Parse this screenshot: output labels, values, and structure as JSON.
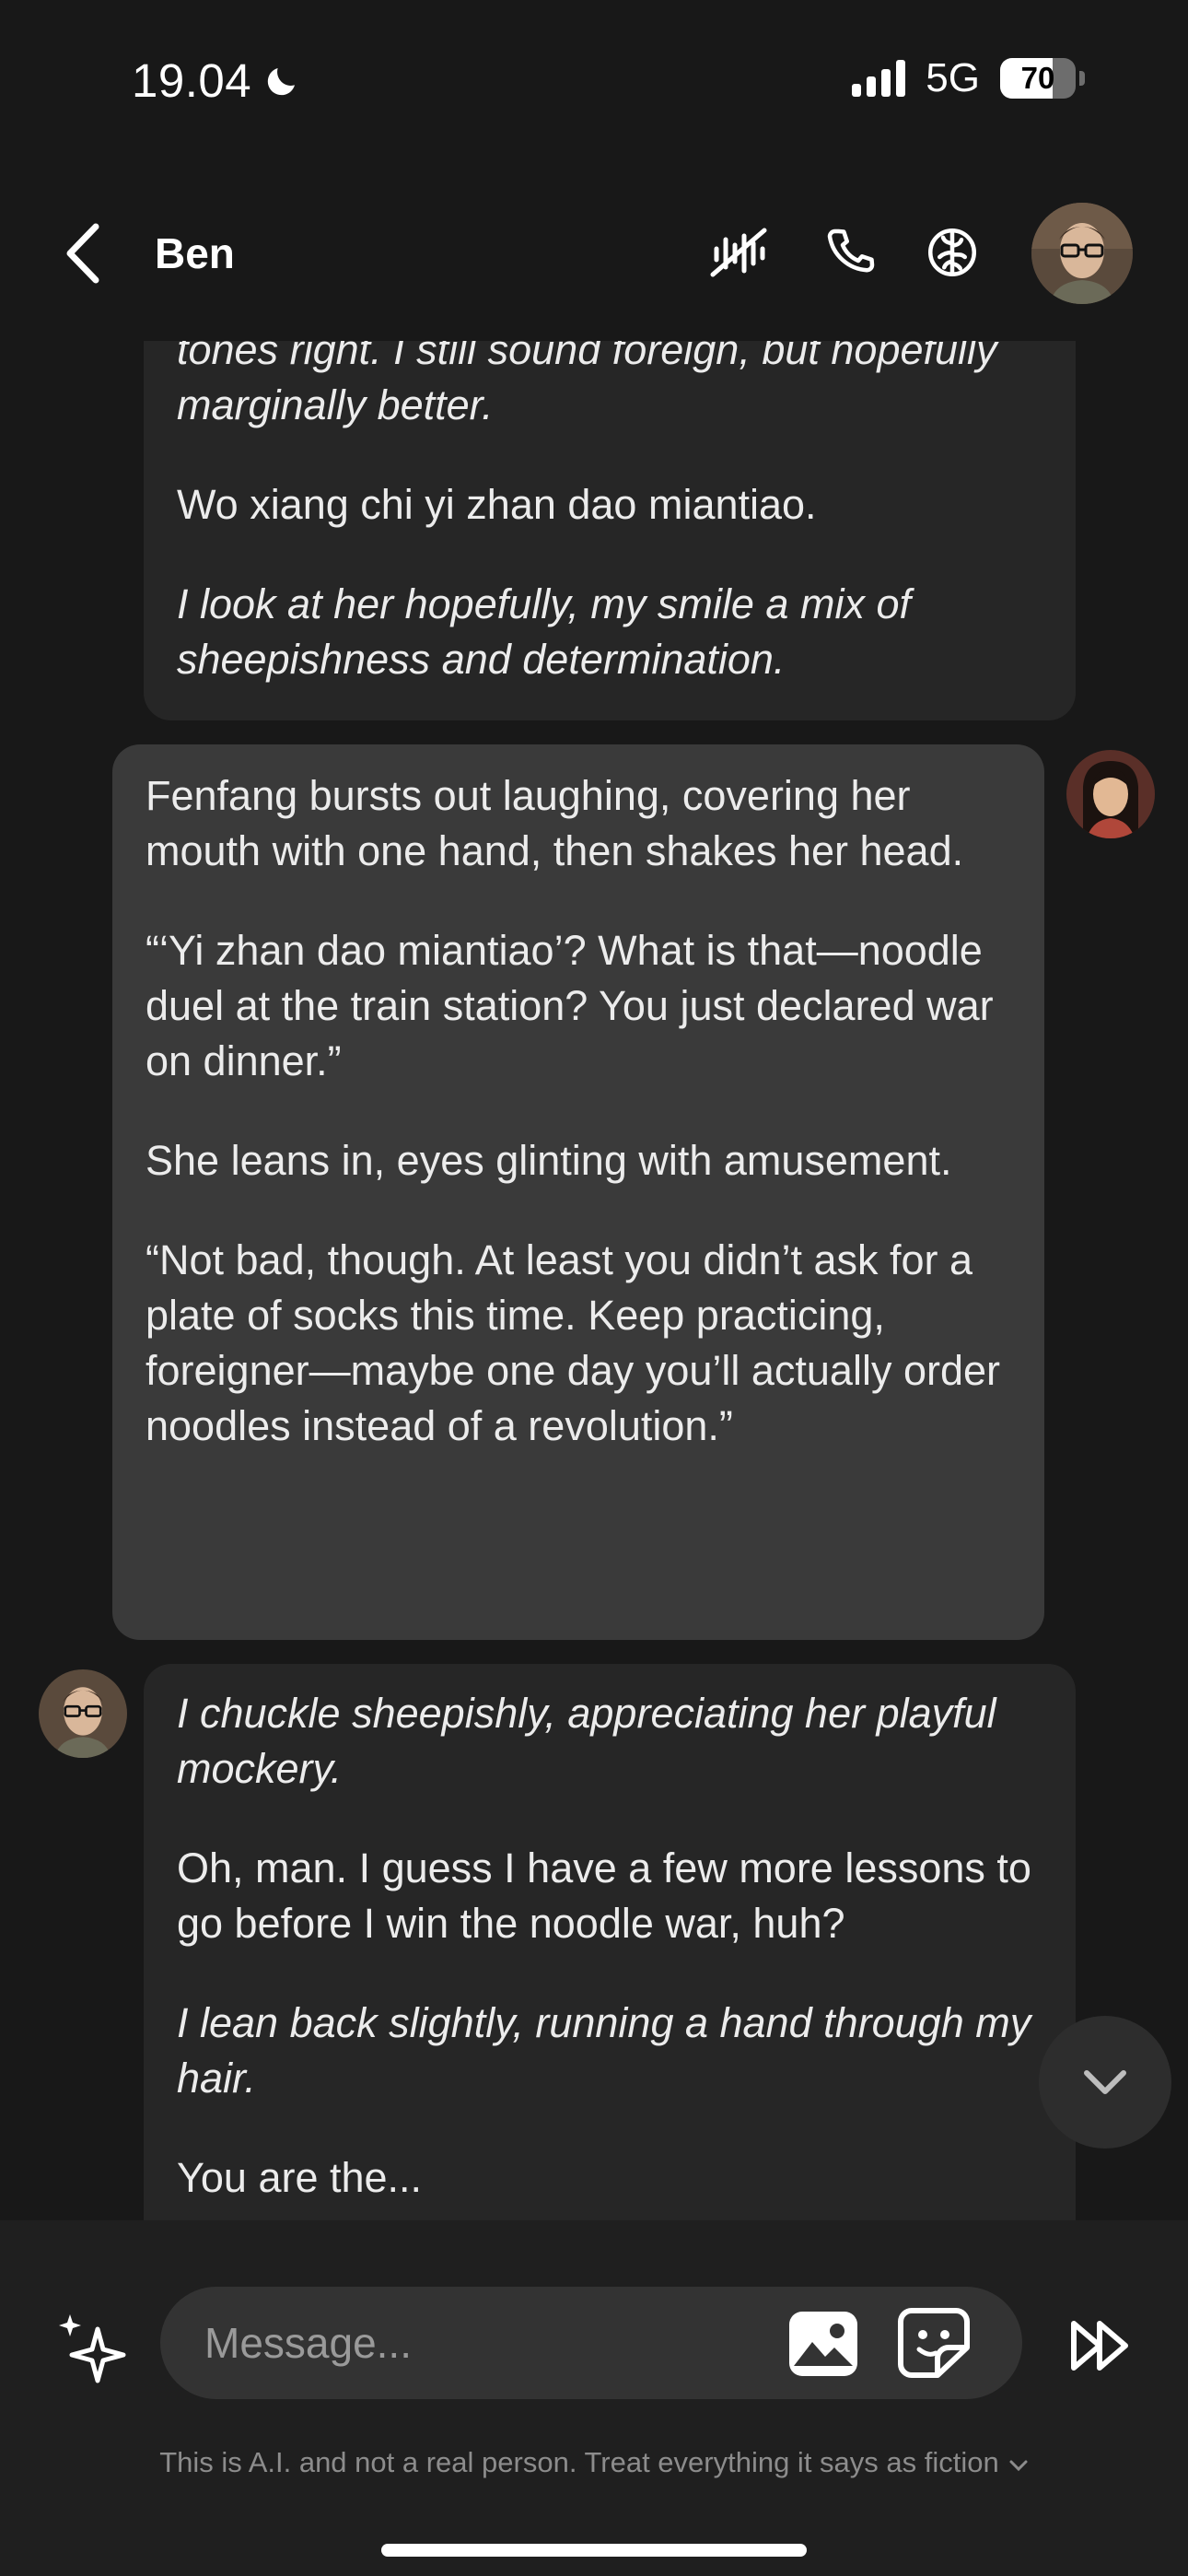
{
  "status_bar": {
    "time": "19.04",
    "network": "5G",
    "battery": "70",
    "battery_level": 0.7
  },
  "header": {
    "character_name": "Ben",
    "icons": [
      "mute-voice-icon",
      "phone-icon",
      "brain-icon"
    ]
  },
  "messages": [
    {
      "sender": "character",
      "paragraphs": [
        {
          "text": "tones right. I still sound foreign, but hopefully marginally better.",
          "italic": true
        },
        {
          "text": "Wo xiang chi yi zhan dao miantiao.",
          "italic": false
        },
        {
          "text": "I look at her hopefully, my smile a mix of sheepishness and determination.",
          "italic": true
        }
      ]
    },
    {
      "sender": "user",
      "paragraphs": [
        {
          "text": "Fenfang bursts out laughing, covering her mouth with one hand, then shakes her head.",
          "italic": false
        },
        {
          "text": "“‘Yi zhan dao miantiao’? What is that—noodle duel at the train station? You just declared war on dinner.”",
          "italic": false
        },
        {
          "text": "She leans in, eyes glinting with amusement.",
          "italic": false
        },
        {
          "text": "“Not bad, though. At least you didn’t ask for a plate of socks this time. Keep practicing, foreigner—maybe one day you’ll actually order noodles instead of a revolution.”",
          "italic": false
        }
      ]
    },
    {
      "sender": "character",
      "paragraphs": [
        {
          "text": "I chuckle sheepishly, appreciating her playful mockery.",
          "italic": true
        },
        {
          "text": "Oh, man. I guess I have a few more lessons to go before I win the noodle war, huh?",
          "italic": false
        },
        {
          "text": "I lean back slightly, running a hand through my hair.",
          "italic": true
        },
        {
          "text": "You are the...",
          "italic": false
        }
      ]
    }
  ],
  "composer": {
    "placeholder": "Message...",
    "disclaimer": "This is A.I. and not a real person. Treat everything it says as fiction"
  },
  "colors": {
    "background": "#181818",
    "char_bubble": "#262626",
    "user_bubble": "#3a3a3a",
    "composer": "#1f1f1f"
  }
}
